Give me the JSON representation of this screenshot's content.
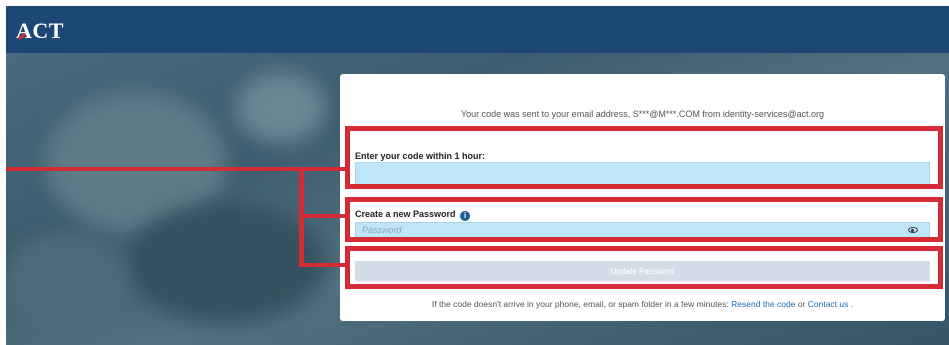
{
  "header": {
    "logo": "ACT"
  },
  "card": {
    "sent_message": "Your code was sent to your email address, S***@M***.COM from identity-services@act.org",
    "code_label": "Enter your code within 1 hour:",
    "code_value": "",
    "password_label": "Create a new Password",
    "password_placeholder": "Password",
    "update_button": "Update Password",
    "footer": {
      "text": "If the code doesn't arrive in your phone, email, or spam folder in a few minutes:",
      "resend_link": "Resend the code",
      "or": "or",
      "contact_link": "Contact us",
      "end": "."
    }
  },
  "icons": {
    "info": "info-icon",
    "eye": "eye-icon"
  },
  "colors": {
    "header": "#1d4876",
    "highlight": "#d52b35",
    "input_bg": "#bfe6f7",
    "link": "#1f6fb2"
  }
}
